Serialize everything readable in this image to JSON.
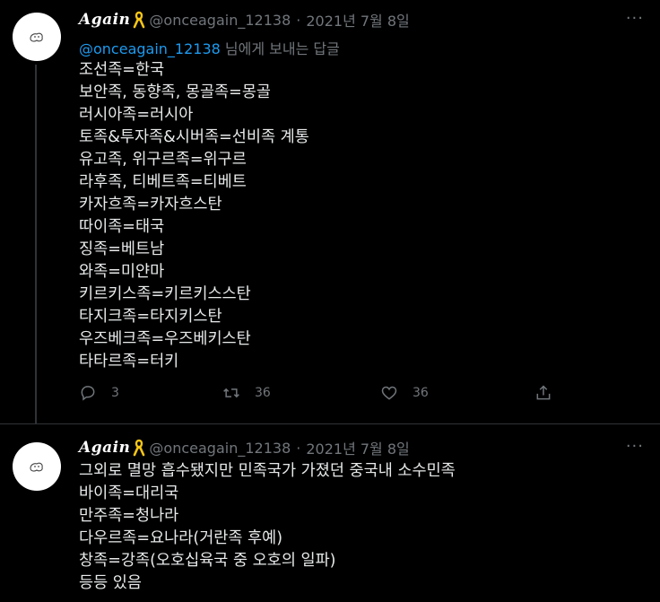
{
  "tweets": [
    {
      "name": "Again",
      "handle": "@onceagain_12138",
      "separator": "·",
      "date": "2021년 7월 8일",
      "more": "···",
      "replying_to": "@onceagain_12138",
      "replying_suffix": " 님에게 보내는 답글",
      "lines": [
        "조선족=한국",
        "보안족, 동향족, 몽골족=몽골",
        "러시아족=러시아",
        "토족&투자족&시버족=선비족 계통",
        "유고족, 위구르족=위구르",
        "라후족, 티베트족=티베트",
        "카자흐족=카자흐스탄",
        "따이족=태국",
        "징족=베트남",
        "와족=미얀마",
        "키르키스족=키르키스스탄",
        "타지크족=타지키스탄",
        "우즈베크족=우즈베키스탄",
        "타타르족=터키"
      ],
      "actions": {
        "reply_count": "3",
        "retweet_count": "36",
        "like_count": "36"
      }
    },
    {
      "name": "Again",
      "handle": "@onceagain_12138",
      "separator": "·",
      "date": "2021년 7월 8일",
      "more": "···",
      "lines": [
        "그외로 멸망 흡수됐지만 민족국가 가졌던 중국내 소수민족",
        "바이족=대리국",
        "만주족=청나라",
        "다우르족=요나라(거란족 후예)",
        "창족=강족(오호십육국 중 오호의 일파)",
        "등등 있음"
      ]
    }
  ],
  "colors": {
    "background": "#000000",
    "text": "#e7e9ea",
    "muted": "#71767b",
    "link": "#1d9bf0",
    "ribbon": "#f5c518",
    "divider": "#2f3336"
  },
  "icons": [
    "avatar-doodle",
    "yellow-ribbon-icon",
    "more-icon",
    "reply-icon",
    "retweet-icon",
    "like-icon",
    "share-icon"
  ]
}
